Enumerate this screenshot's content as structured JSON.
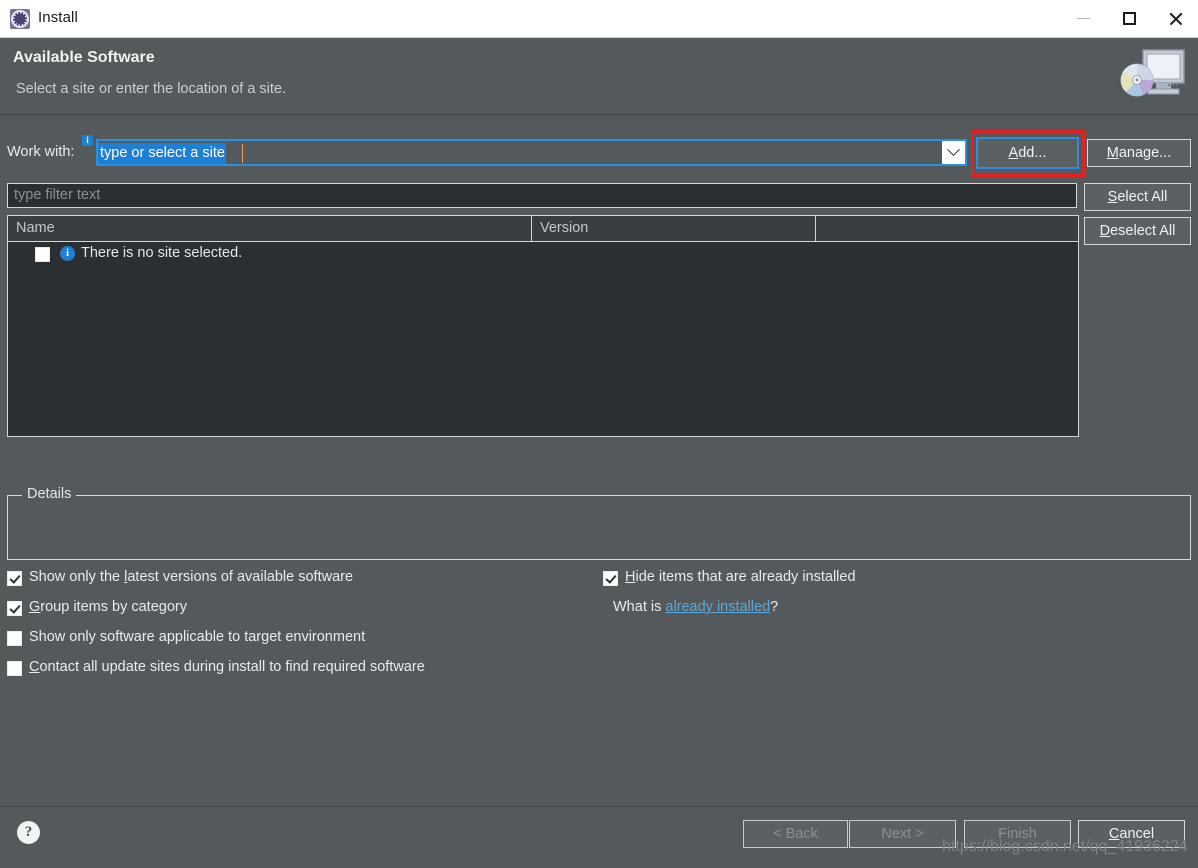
{
  "window": {
    "title": "Install",
    "icon": "eclipse-install-icon",
    "controls": {
      "minimize": "minimize-icon",
      "maximize": "maximize-icon",
      "close": "close-icon"
    }
  },
  "banner": {
    "title": "Available Software",
    "subtitle": "Select a site or enter the location of a site.",
    "art_icon": "monitor-with-disc-icon"
  },
  "work_with": {
    "label": "Work with:",
    "info_badge": "i",
    "value": "type or select a site",
    "placeholder": "type or select a site",
    "dropdown_icon": "chevron-down-icon"
  },
  "buttons": {
    "add": "Add...",
    "manage": "Manage...",
    "select_all": "Select All",
    "deselect_all": "Deselect All"
  },
  "filter": {
    "placeholder": "type filter text",
    "value": ""
  },
  "table": {
    "columns": [
      "Name",
      "Version",
      ""
    ],
    "rows": [
      {
        "checked": false,
        "icon": "info-icon",
        "name": "There is no site selected.",
        "version": ""
      }
    ]
  },
  "details": {
    "legend": "Details",
    "text": ""
  },
  "options": [
    {
      "id": "latest",
      "label": "Show only the latest versions of available software",
      "checked": true
    },
    {
      "id": "group",
      "label": "Group items by category",
      "checked": true
    },
    {
      "id": "target",
      "label": "Show only software applicable to target environment",
      "checked": false
    },
    {
      "id": "contact",
      "label": "Contact all update sites during install to find required software",
      "checked": false
    },
    {
      "id": "hide",
      "label": "Hide items that are already installed",
      "checked": true
    }
  ],
  "what_is": {
    "prefix": "What is ",
    "link": "already installed",
    "suffix": "?"
  },
  "footer": {
    "help_icon": "?",
    "back": "< Back",
    "next": "Next >",
    "finish": "Finish",
    "cancel": "Cancel"
  },
  "annotation": {
    "highlight_target": "add-button",
    "color": "#e81f23"
  },
  "watermark": "https://blog.csdn.net/qq_41936224",
  "colors": {
    "dialog_bg": "#54595c",
    "titlebar_bg": "#ffffff",
    "field_bg": "#2c2f31",
    "accent_blue": "#2a8fe0",
    "selection_blue": "#1e7fd4",
    "link_blue": "#5fa8d8",
    "text": "#e9ebec",
    "disabled_text": "#8b9093",
    "annotation_red": "#e81f23"
  }
}
